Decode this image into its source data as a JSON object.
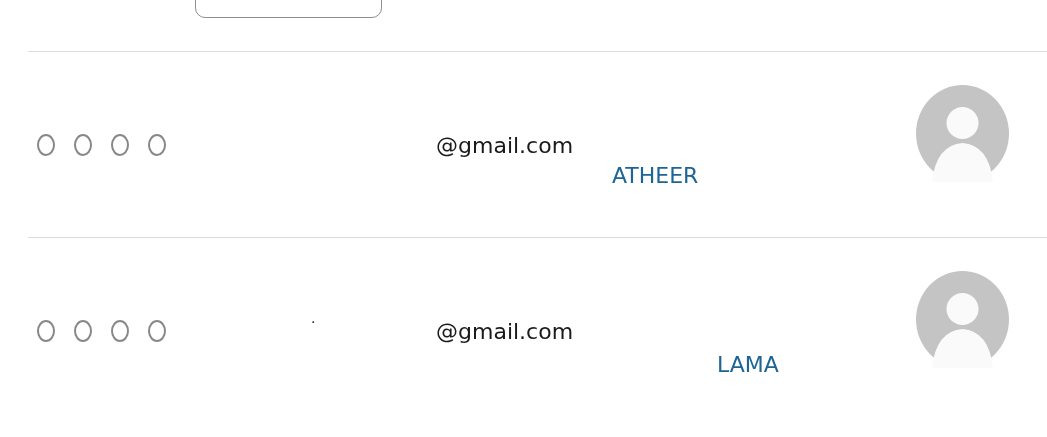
{
  "rows": [
    {
      "stars": 0,
      "dot": "",
      "email": "@gmail.com",
      "name": "ATHEER"
    },
    {
      "stars": 0,
      "dot": ".",
      "email": "@gmail.com",
      "name": "LAMA"
    }
  ]
}
